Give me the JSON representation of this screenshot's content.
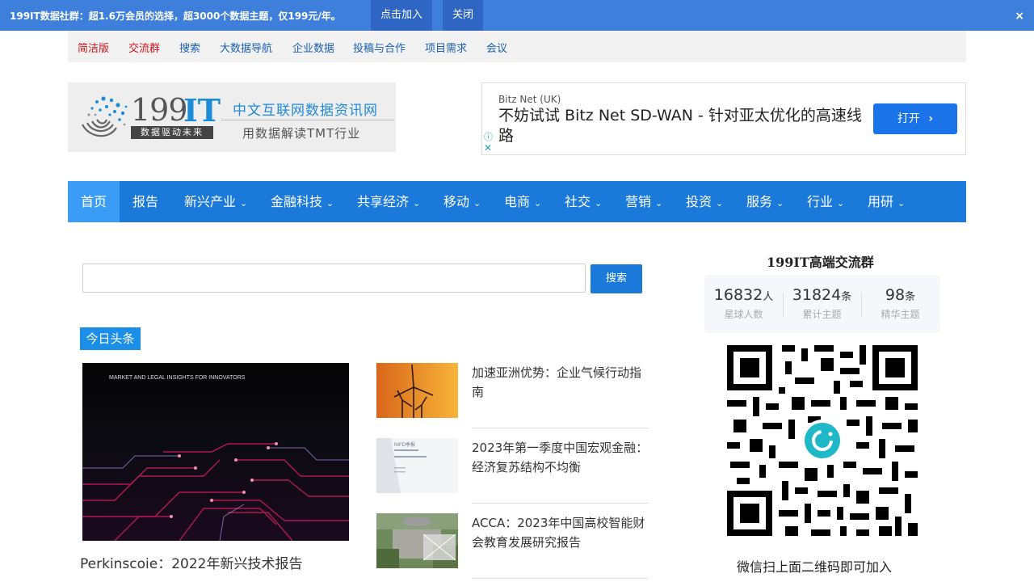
{
  "promo": {
    "text": "199IT数据社群：超1.6万会员的选择，超3000个数据主题，仅199元/年。",
    "join_label": "点击加入",
    "close_label": "关闭",
    "dismiss_icon": "×"
  },
  "subnav": {
    "items": [
      "简洁版",
      "交流群",
      "搜索",
      "大数据导航",
      "企业数据",
      "投稿与合作",
      "项目需求",
      "会议"
    ]
  },
  "logo": {
    "num": "199",
    "it": "IT",
    "tagline": "数据驱动未来",
    "cn_title": "中文互联网数据资讯网",
    "cn_sub": "用数据解读TMT行业"
  },
  "ad": {
    "source": "Bitz Net (UK)",
    "title": "不妨试试 Bitz Net SD-WAN - 针对亚太优化的高速线路",
    "button_label": "打开",
    "button_arrow": "›",
    "info_icon": "ⓘ",
    "close_icon": "✕"
  },
  "mainnav": {
    "items": [
      {
        "label": "首页",
        "dropdown": false
      },
      {
        "label": "报告",
        "dropdown": false
      },
      {
        "label": "新兴产业",
        "dropdown": true
      },
      {
        "label": "金融科技",
        "dropdown": true
      },
      {
        "label": "共享经济",
        "dropdown": true
      },
      {
        "label": "移动",
        "dropdown": true
      },
      {
        "label": "电商",
        "dropdown": true
      },
      {
        "label": "社交",
        "dropdown": true
      },
      {
        "label": "营销",
        "dropdown": true
      },
      {
        "label": "投资",
        "dropdown": true
      },
      {
        "label": "服务",
        "dropdown": true
      },
      {
        "label": "行业",
        "dropdown": true
      },
      {
        "label": "用研",
        "dropdown": true
      }
    ],
    "caret": "⌄"
  },
  "search": {
    "value": "",
    "button_label": "搜索"
  },
  "headlines": {
    "label": "今日头条",
    "feature": {
      "image_caption": "MARKET AND LEGAL INSIGHTS FOR INNOVATORS",
      "title": "Perkinscoie：2022年新兴技术报告"
    },
    "articles": [
      {
        "title": "加速亚洲优势：企业气候行动指南"
      },
      {
        "title": "2023年第一季度中国宏观金融：经济复苏结构不均衡",
        "thumb_text": "NIFD季报"
      },
      {
        "title": "ACCA：2023年中国高校智能财会教育发展研究报告"
      }
    ]
  },
  "widget": {
    "title": "199IT高端交流群",
    "stats": [
      {
        "value": "16832",
        "unit": "人",
        "label": "星球人数"
      },
      {
        "value": "31824",
        "unit": "条",
        "label": "累计主题"
      },
      {
        "value": "98",
        "unit": "条",
        "label": "精华主题"
      }
    ],
    "caption": "微信扫上面二维码即可加入"
  },
  "colors": {
    "promo_bg": "#3e7fdc",
    "nav_bg": "#1b7ad9",
    "nav_active": "#3a9cf5",
    "link_blue": "#1a5fb4",
    "link_red": "#d9111b"
  }
}
